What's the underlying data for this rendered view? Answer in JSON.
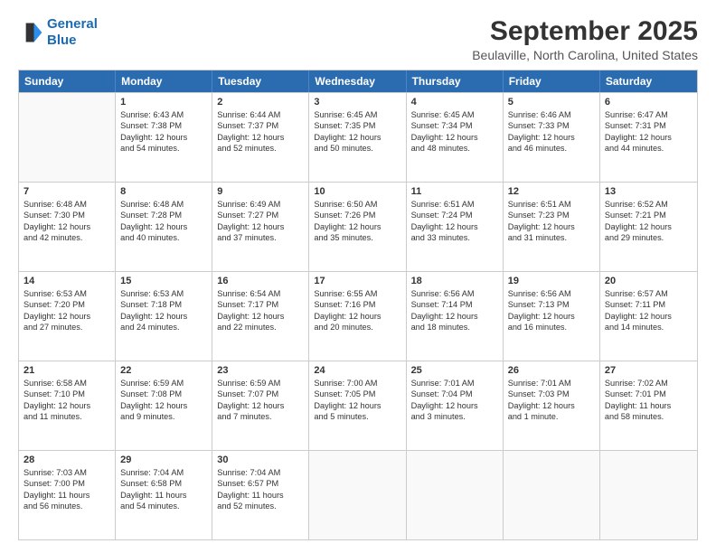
{
  "logo": {
    "line1": "General",
    "line2": "Blue"
  },
  "title": "September 2025",
  "location": "Beulaville, North Carolina, United States",
  "header_days": [
    "Sunday",
    "Monday",
    "Tuesday",
    "Wednesday",
    "Thursday",
    "Friday",
    "Saturday"
  ],
  "weeks": [
    [
      {
        "day": "",
        "lines": []
      },
      {
        "day": "1",
        "lines": [
          "Sunrise: 6:43 AM",
          "Sunset: 7:38 PM",
          "Daylight: 12 hours",
          "and 54 minutes."
        ]
      },
      {
        "day": "2",
        "lines": [
          "Sunrise: 6:44 AM",
          "Sunset: 7:37 PM",
          "Daylight: 12 hours",
          "and 52 minutes."
        ]
      },
      {
        "day": "3",
        "lines": [
          "Sunrise: 6:45 AM",
          "Sunset: 7:35 PM",
          "Daylight: 12 hours",
          "and 50 minutes."
        ]
      },
      {
        "day": "4",
        "lines": [
          "Sunrise: 6:45 AM",
          "Sunset: 7:34 PM",
          "Daylight: 12 hours",
          "and 48 minutes."
        ]
      },
      {
        "day": "5",
        "lines": [
          "Sunrise: 6:46 AM",
          "Sunset: 7:33 PM",
          "Daylight: 12 hours",
          "and 46 minutes."
        ]
      },
      {
        "day": "6",
        "lines": [
          "Sunrise: 6:47 AM",
          "Sunset: 7:31 PM",
          "Daylight: 12 hours",
          "and 44 minutes."
        ]
      }
    ],
    [
      {
        "day": "7",
        "lines": [
          "Sunrise: 6:48 AM",
          "Sunset: 7:30 PM",
          "Daylight: 12 hours",
          "and 42 minutes."
        ]
      },
      {
        "day": "8",
        "lines": [
          "Sunrise: 6:48 AM",
          "Sunset: 7:28 PM",
          "Daylight: 12 hours",
          "and 40 minutes."
        ]
      },
      {
        "day": "9",
        "lines": [
          "Sunrise: 6:49 AM",
          "Sunset: 7:27 PM",
          "Daylight: 12 hours",
          "and 37 minutes."
        ]
      },
      {
        "day": "10",
        "lines": [
          "Sunrise: 6:50 AM",
          "Sunset: 7:26 PM",
          "Daylight: 12 hours",
          "and 35 minutes."
        ]
      },
      {
        "day": "11",
        "lines": [
          "Sunrise: 6:51 AM",
          "Sunset: 7:24 PM",
          "Daylight: 12 hours",
          "and 33 minutes."
        ]
      },
      {
        "day": "12",
        "lines": [
          "Sunrise: 6:51 AM",
          "Sunset: 7:23 PM",
          "Daylight: 12 hours",
          "and 31 minutes."
        ]
      },
      {
        "day": "13",
        "lines": [
          "Sunrise: 6:52 AM",
          "Sunset: 7:21 PM",
          "Daylight: 12 hours",
          "and 29 minutes."
        ]
      }
    ],
    [
      {
        "day": "14",
        "lines": [
          "Sunrise: 6:53 AM",
          "Sunset: 7:20 PM",
          "Daylight: 12 hours",
          "and 27 minutes."
        ]
      },
      {
        "day": "15",
        "lines": [
          "Sunrise: 6:53 AM",
          "Sunset: 7:18 PM",
          "Daylight: 12 hours",
          "and 24 minutes."
        ]
      },
      {
        "day": "16",
        "lines": [
          "Sunrise: 6:54 AM",
          "Sunset: 7:17 PM",
          "Daylight: 12 hours",
          "and 22 minutes."
        ]
      },
      {
        "day": "17",
        "lines": [
          "Sunrise: 6:55 AM",
          "Sunset: 7:16 PM",
          "Daylight: 12 hours",
          "and 20 minutes."
        ]
      },
      {
        "day": "18",
        "lines": [
          "Sunrise: 6:56 AM",
          "Sunset: 7:14 PM",
          "Daylight: 12 hours",
          "and 18 minutes."
        ]
      },
      {
        "day": "19",
        "lines": [
          "Sunrise: 6:56 AM",
          "Sunset: 7:13 PM",
          "Daylight: 12 hours",
          "and 16 minutes."
        ]
      },
      {
        "day": "20",
        "lines": [
          "Sunrise: 6:57 AM",
          "Sunset: 7:11 PM",
          "Daylight: 12 hours",
          "and 14 minutes."
        ]
      }
    ],
    [
      {
        "day": "21",
        "lines": [
          "Sunrise: 6:58 AM",
          "Sunset: 7:10 PM",
          "Daylight: 12 hours",
          "and 11 minutes."
        ]
      },
      {
        "day": "22",
        "lines": [
          "Sunrise: 6:59 AM",
          "Sunset: 7:08 PM",
          "Daylight: 12 hours",
          "and 9 minutes."
        ]
      },
      {
        "day": "23",
        "lines": [
          "Sunrise: 6:59 AM",
          "Sunset: 7:07 PM",
          "Daylight: 12 hours",
          "and 7 minutes."
        ]
      },
      {
        "day": "24",
        "lines": [
          "Sunrise: 7:00 AM",
          "Sunset: 7:05 PM",
          "Daylight: 12 hours",
          "and 5 minutes."
        ]
      },
      {
        "day": "25",
        "lines": [
          "Sunrise: 7:01 AM",
          "Sunset: 7:04 PM",
          "Daylight: 12 hours",
          "and 3 minutes."
        ]
      },
      {
        "day": "26",
        "lines": [
          "Sunrise: 7:01 AM",
          "Sunset: 7:03 PM",
          "Daylight: 12 hours",
          "and 1 minute."
        ]
      },
      {
        "day": "27",
        "lines": [
          "Sunrise: 7:02 AM",
          "Sunset: 7:01 PM",
          "Daylight: 11 hours",
          "and 58 minutes."
        ]
      }
    ],
    [
      {
        "day": "28",
        "lines": [
          "Sunrise: 7:03 AM",
          "Sunset: 7:00 PM",
          "Daylight: 11 hours",
          "and 56 minutes."
        ]
      },
      {
        "day": "29",
        "lines": [
          "Sunrise: 7:04 AM",
          "Sunset: 6:58 PM",
          "Daylight: 11 hours",
          "and 54 minutes."
        ]
      },
      {
        "day": "30",
        "lines": [
          "Sunrise: 7:04 AM",
          "Sunset: 6:57 PM",
          "Daylight: 11 hours",
          "and 52 minutes."
        ]
      },
      {
        "day": "",
        "lines": []
      },
      {
        "day": "",
        "lines": []
      },
      {
        "day": "",
        "lines": []
      },
      {
        "day": "",
        "lines": []
      }
    ]
  ]
}
